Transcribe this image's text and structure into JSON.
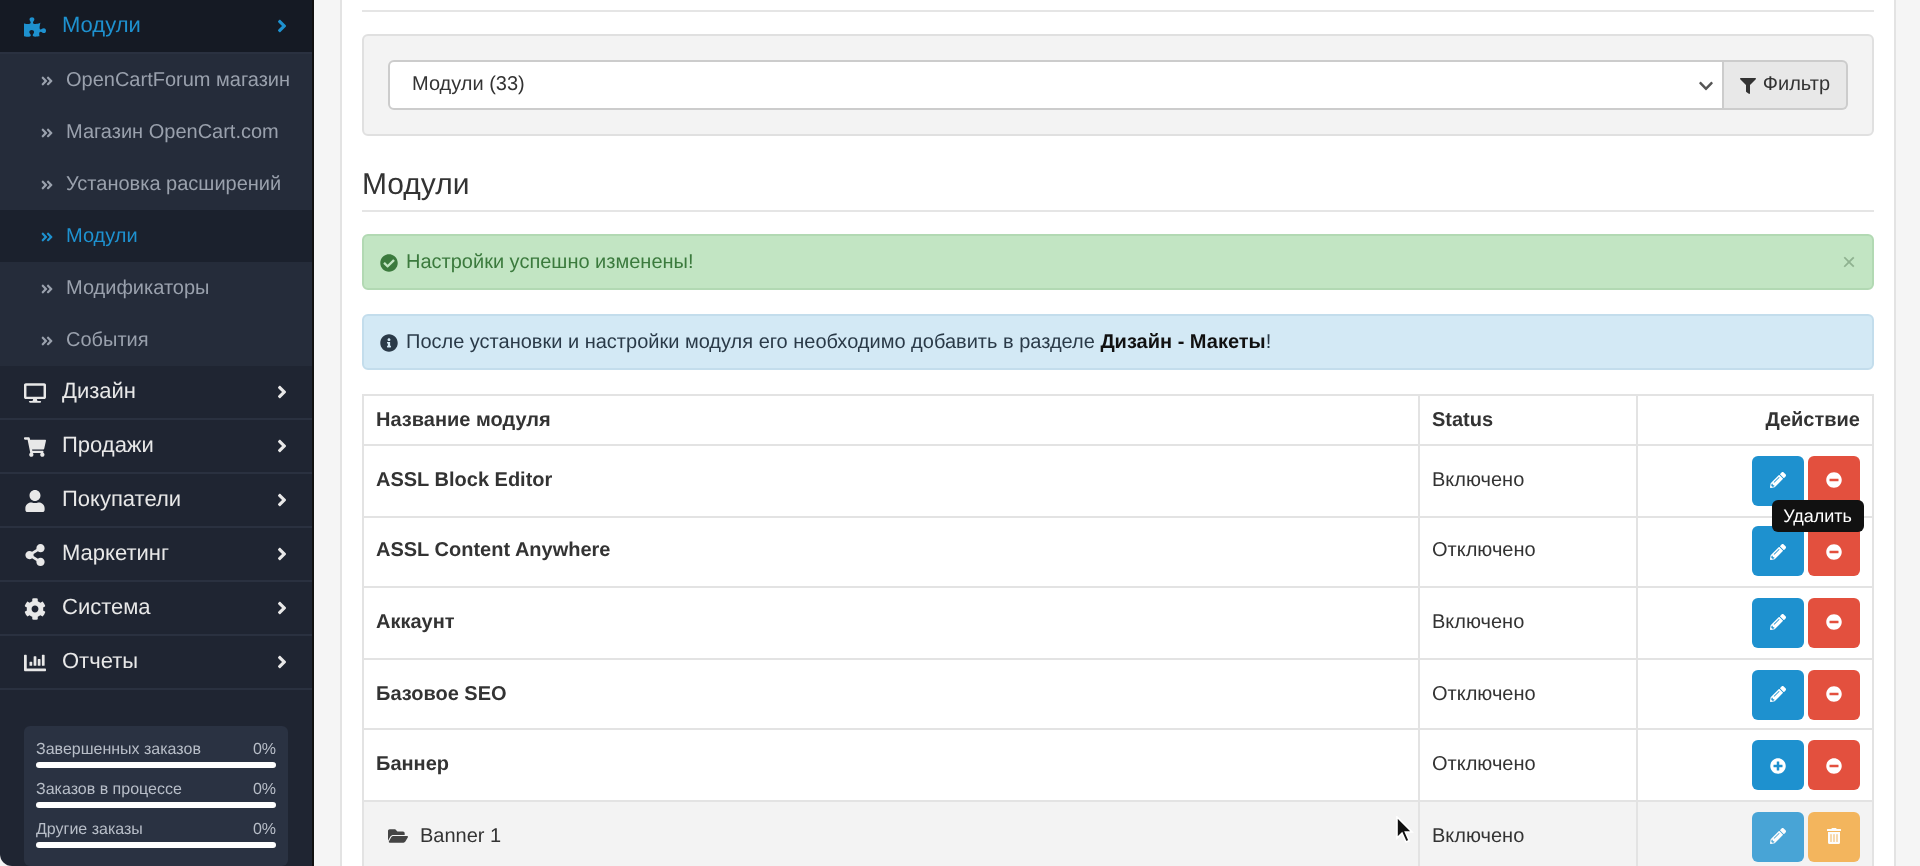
{
  "sidebar": {
    "items": [
      {
        "label": "Модули",
        "selected": true,
        "children": [
          {
            "label": "OpenCartForum магазин",
            "selected": false
          },
          {
            "label": "Магазин OpenCart.com",
            "selected": false
          },
          {
            "label": "Установка расширений",
            "selected": false
          },
          {
            "label": "Модули",
            "selected": true
          },
          {
            "label": "Модификаторы",
            "selected": false
          },
          {
            "label": "События",
            "selected": false
          }
        ]
      },
      {
        "label": "Дизайн",
        "selected": false
      },
      {
        "label": "Продажи",
        "selected": false
      },
      {
        "label": "Покупатели",
        "selected": false
      },
      {
        "label": "Маркетинг",
        "selected": false
      },
      {
        "label": "Система",
        "selected": false
      },
      {
        "label": "Отчеты",
        "selected": false
      }
    ],
    "stats": [
      {
        "label": "Завершенных заказов",
        "value": "0%",
        "level": 0
      },
      {
        "label": "Заказов в процессе",
        "value": "0%",
        "level": 0
      },
      {
        "label": "Другие заказы",
        "value": "0%",
        "level": 0
      }
    ]
  },
  "filter": {
    "select_value": "Модули (33)",
    "button": "Фильтр"
  },
  "heading": "Модули",
  "alerts": [
    {
      "kind": "success",
      "text": "Настройки успешно изменены!",
      "close": "×"
    },
    {
      "kind": "info",
      "text": "После установки и настройки модуля его необходимо добавить в разделе **Дизайн - Макеты**!"
    }
  ],
  "table": {
    "columns": [
      "Название модуля",
      "Status",
      "Действие"
    ],
    "rows": [
      {
        "kind": "module",
        "name": "ASSL Block Editor",
        "status": "Включено",
        "tooltip": "Удалить"
      },
      {
        "kind": "module",
        "name": "ASSL Content Anywhere",
        "status": "Отключено"
      },
      {
        "kind": "module",
        "name": "Аккаунт",
        "status": "Включено"
      },
      {
        "kind": "module",
        "name": "Базовое SEO",
        "status": "Отключено"
      },
      {
        "kind": "uninstalled",
        "name": "Баннер",
        "status": "Отключено"
      },
      {
        "kind": "instance",
        "name": "Banner 1",
        "status": "Включено"
      }
    ]
  }
}
